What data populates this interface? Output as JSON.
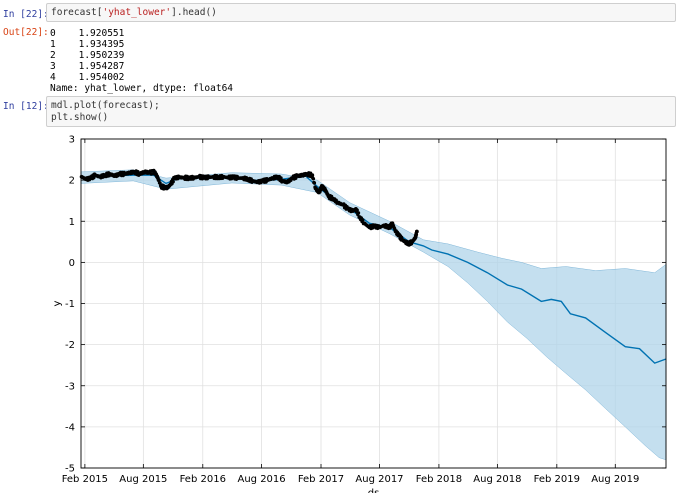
{
  "cell22": {
    "in_prompt": "In [22]:",
    "code_pre": "forecast[",
    "code_str": "'yhat_lower'",
    "code_post": "].head()",
    "out_prompt": "Out[22]:",
    "out_lines": [
      "0    1.920551",
      "1    1.934395",
      "2    1.950239",
      "3    1.954287",
      "4    1.954002",
      "Name: yhat_lower, dtype: float64"
    ]
  },
  "cell12": {
    "in_prompt": "In [12]:",
    "code_lines": [
      "mdl.plot(forecast);",
      "plt.show()"
    ]
  },
  "chart_data": {
    "type": "line",
    "xlabel": "ds",
    "ylabel": "y",
    "ylim": [
      -5,
      3
    ],
    "yticks": [
      3,
      2,
      1,
      0,
      -1,
      -2,
      -3,
      -4,
      -5
    ],
    "xlim": [
      "2015-01-20",
      "2020-01-05"
    ],
    "xticks": [
      {
        "date": "2015-02-01",
        "label": "Feb 2015"
      },
      {
        "date": "2015-08-01",
        "label": "Aug 2015"
      },
      {
        "date": "2016-02-01",
        "label": "Feb 2016"
      },
      {
        "date": "2016-08-01",
        "label": "Aug 2016"
      },
      {
        "date": "2017-02-01",
        "label": "Feb 2017"
      },
      {
        "date": "2017-08-01",
        "label": "Aug 2017"
      },
      {
        "date": "2018-02-01",
        "label": "Feb 2018"
      },
      {
        "date": "2018-08-01",
        "label": "Aug 2018"
      },
      {
        "date": "2019-02-01",
        "label": "Feb 2019"
      },
      {
        "date": "2019-08-01",
        "label": "Aug 2019"
      }
    ],
    "grid": true,
    "colors": {
      "forecast": "#0072b2",
      "band": "#b0d4ea",
      "observed": "#000000"
    },
    "series": [
      {
        "role": "observed",
        "points": [
          [
            "2015-01-22",
            2.08
          ],
          [
            "2015-02-05",
            2.02
          ],
          [
            "2015-02-20",
            2.05
          ],
          [
            "2015-03-05",
            2.12
          ],
          [
            "2015-03-20",
            2.08
          ],
          [
            "2015-04-05",
            2.12
          ],
          [
            "2015-04-20",
            2.15
          ],
          [
            "2015-05-05",
            2.1
          ],
          [
            "2015-05-20",
            2.15
          ],
          [
            "2015-06-05",
            2.15
          ],
          [
            "2015-06-20",
            2.18
          ],
          [
            "2015-07-05",
            2.2
          ],
          [
            "2015-07-20",
            2.15
          ],
          [
            "2015-08-05",
            2.2
          ],
          [
            "2015-08-20",
            2.18
          ],
          [
            "2015-09-05",
            2.2
          ],
          [
            "2015-09-15",
            2.05
          ],
          [
            "2015-09-25",
            1.85
          ],
          [
            "2015-10-05",
            1.82
          ],
          [
            "2015-10-15",
            1.82
          ],
          [
            "2015-10-25",
            1.9
          ],
          [
            "2015-11-05",
            2.05
          ],
          [
            "2015-11-20",
            2.07
          ],
          [
            "2015-12-05",
            2.06
          ],
          [
            "2015-12-20",
            2.05
          ],
          [
            "2016-01-05",
            2.06
          ],
          [
            "2016-01-20",
            2.08
          ],
          [
            "2016-02-05",
            2.06
          ],
          [
            "2016-02-20",
            2.07
          ],
          [
            "2016-03-05",
            2.08
          ],
          [
            "2016-03-20",
            2.07
          ],
          [
            "2016-04-05",
            2.08
          ],
          [
            "2016-04-20",
            2.06
          ],
          [
            "2016-05-05",
            2.07
          ],
          [
            "2016-05-20",
            2.05
          ],
          [
            "2016-06-05",
            2.05
          ],
          [
            "2016-06-20",
            2.02
          ],
          [
            "2016-07-05",
            1.98
          ],
          [
            "2016-07-20",
            1.95
          ],
          [
            "2016-08-05",
            1.98
          ],
          [
            "2016-08-20",
            2.0
          ],
          [
            "2016-09-05",
            2.05
          ],
          [
            "2016-09-20",
            2.08
          ],
          [
            "2016-10-05",
            1.98
          ],
          [
            "2016-10-20",
            1.95
          ],
          [
            "2016-11-05",
            2.05
          ],
          [
            "2016-11-20",
            2.1
          ],
          [
            "2016-12-05",
            2.12
          ],
          [
            "2016-12-20",
            2.15
          ],
          [
            "2017-01-05",
            2.12
          ],
          [
            "2017-01-15",
            1.8
          ],
          [
            "2017-01-25",
            1.7
          ],
          [
            "2017-02-05",
            1.85
          ],
          [
            "2017-02-15",
            1.75
          ],
          [
            "2017-02-25",
            1.6
          ],
          [
            "2017-03-10",
            1.55
          ],
          [
            "2017-03-25",
            1.45
          ],
          [
            "2017-04-10",
            1.4
          ],
          [
            "2017-04-25",
            1.3
          ],
          [
            "2017-05-10",
            1.25
          ],
          [
            "2017-05-20",
            1.3
          ],
          [
            "2017-06-01",
            1.1
          ],
          [
            "2017-06-15",
            0.95
          ],
          [
            "2017-07-01",
            0.85
          ],
          [
            "2017-07-15",
            0.88
          ],
          [
            "2017-08-01",
            0.85
          ],
          [
            "2017-08-15",
            0.9
          ],
          [
            "2017-09-01",
            0.85
          ],
          [
            "2017-09-10",
            0.95
          ],
          [
            "2017-09-20",
            0.75
          ],
          [
            "2017-10-01",
            0.65
          ],
          [
            "2017-10-10",
            0.55
          ],
          [
            "2017-10-20",
            0.5
          ],
          [
            "2017-10-30",
            0.45
          ],
          [
            "2017-11-10",
            0.5
          ],
          [
            "2017-11-20",
            0.6
          ],
          [
            "2017-11-25",
            0.75
          ]
        ]
      },
      {
        "role": "forecast",
        "points": [
          [
            "2015-01-20",
            2.05
          ],
          [
            "2015-04-01",
            2.1
          ],
          [
            "2015-07-01",
            2.12
          ],
          [
            "2015-09-01",
            2.12
          ],
          [
            "2015-10-10",
            1.92
          ],
          [
            "2015-11-15",
            2.03
          ],
          [
            "2016-02-01",
            2.06
          ],
          [
            "2016-05-01",
            2.06
          ],
          [
            "2016-08-01",
            1.98
          ],
          [
            "2016-10-01",
            2.02
          ],
          [
            "2016-12-15",
            2.1
          ],
          [
            "2017-01-20",
            1.85
          ],
          [
            "2017-03-01",
            1.6
          ],
          [
            "2017-05-01",
            1.3
          ],
          [
            "2017-07-01",
            0.95
          ],
          [
            "2017-09-01",
            0.85
          ],
          [
            "2017-11-01",
            0.5
          ],
          [
            "2017-12-15",
            0.4
          ],
          [
            "2018-01-10",
            0.3
          ],
          [
            "2018-03-01",
            0.2
          ],
          [
            "2018-05-01",
            0.0
          ],
          [
            "2018-07-01",
            -0.25
          ],
          [
            "2018-09-01",
            -0.55
          ],
          [
            "2018-10-15",
            -0.65
          ],
          [
            "2018-12-15",
            -0.95
          ],
          [
            "2019-01-15",
            -0.9
          ],
          [
            "2019-02-15",
            -0.95
          ],
          [
            "2019-03-15",
            -1.25
          ],
          [
            "2019-05-01",
            -1.35
          ],
          [
            "2019-07-01",
            -1.7
          ],
          [
            "2019-09-01",
            -2.05
          ],
          [
            "2019-10-15",
            -2.1
          ],
          [
            "2019-12-01",
            -2.45
          ],
          [
            "2020-01-05",
            -2.35
          ]
        ]
      },
      {
        "role": "upper-bound",
        "points": [
          [
            "2015-01-20",
            2.2
          ],
          [
            "2015-07-01",
            2.25
          ],
          [
            "2015-10-10",
            2.05
          ],
          [
            "2016-05-01",
            2.18
          ],
          [
            "2016-10-01",
            2.15
          ],
          [
            "2017-01-20",
            2.0
          ],
          [
            "2017-05-01",
            1.45
          ],
          [
            "2017-09-01",
            1.0
          ],
          [
            "2017-12-15",
            0.55
          ],
          [
            "2018-03-01",
            0.45
          ],
          [
            "2018-06-01",
            0.25
          ],
          [
            "2018-08-15",
            0.1
          ],
          [
            "2018-10-15",
            0.0
          ],
          [
            "2018-12-15",
            -0.15
          ],
          [
            "2019-03-01",
            -0.1
          ],
          [
            "2019-06-01",
            -0.2
          ],
          [
            "2019-09-01",
            -0.15
          ],
          [
            "2019-12-01",
            -0.25
          ],
          [
            "2020-01-05",
            -0.05
          ]
        ]
      },
      {
        "role": "lower-bound",
        "points": [
          [
            "2015-01-20",
            1.92
          ],
          [
            "2015-07-01",
            1.98
          ],
          [
            "2015-10-10",
            1.78
          ],
          [
            "2016-05-01",
            1.93
          ],
          [
            "2016-10-01",
            1.88
          ],
          [
            "2017-01-20",
            1.7
          ],
          [
            "2017-05-01",
            1.15
          ],
          [
            "2017-09-01",
            0.7
          ],
          [
            "2017-12-15",
            0.25
          ],
          [
            "2018-03-01",
            -0.1
          ],
          [
            "2018-05-01",
            -0.5
          ],
          [
            "2018-07-01",
            -0.95
          ],
          [
            "2018-09-01",
            -1.45
          ],
          [
            "2018-11-01",
            -1.85
          ],
          [
            "2019-01-01",
            -2.3
          ],
          [
            "2019-03-01",
            -2.7
          ],
          [
            "2019-05-01",
            -3.1
          ],
          [
            "2019-07-01",
            -3.55
          ],
          [
            "2019-09-01",
            -4.0
          ],
          [
            "2019-11-01",
            -4.45
          ],
          [
            "2019-12-15",
            -4.75
          ],
          [
            "2020-01-05",
            -4.8
          ]
        ]
      }
    ]
  }
}
